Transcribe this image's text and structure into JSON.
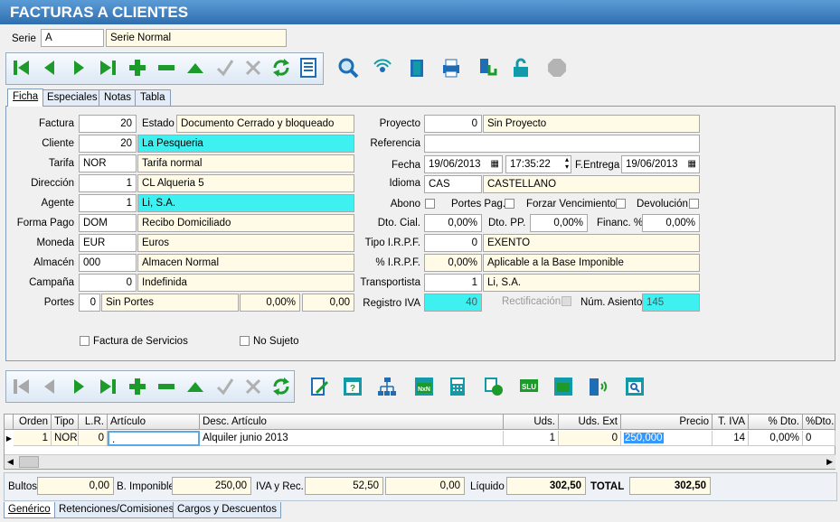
{
  "title": "FACTURAS A CLIENTES",
  "serie": {
    "label": "Serie",
    "code": "A",
    "name": "Serie Normal"
  },
  "tabs": [
    "Ficha",
    "Especiales",
    "Notas",
    "Tabla"
  ],
  "left": {
    "factura": {
      "label": "Factura",
      "value": "20"
    },
    "estado": {
      "label": "Estado",
      "value": "Documento Cerrado y bloqueado"
    },
    "cliente": {
      "label": "Cliente",
      "code": "20",
      "name": "La Pesqueria"
    },
    "tarifa": {
      "label": "Tarifa",
      "code": "NOR",
      "name": "Tarifa normal"
    },
    "direccion": {
      "label": "Dirección",
      "code": "1",
      "name": "CL  Alqueria 5"
    },
    "agente": {
      "label": "Agente",
      "code": "1",
      "name": "Li, S.A."
    },
    "forma_pago": {
      "label": "Forma Pago",
      "code": "DOM",
      "name": "Recibo Domiciliado"
    },
    "moneda": {
      "label": "Moneda",
      "code": "EUR",
      "name": "Euros"
    },
    "almacen": {
      "label": "Almacén",
      "code": "000",
      "name": "Almacen Normal"
    },
    "campana": {
      "label": "Campaña",
      "code": "0",
      "name": "Indefinida"
    },
    "portes": {
      "label": "Portes",
      "code": "0",
      "name": "Sin Portes",
      "pct": "0,00%",
      "amount": "0,00"
    }
  },
  "right": {
    "proyecto": {
      "label": "Proyecto",
      "code": "0",
      "name": "Sin Proyecto"
    },
    "referencia": {
      "label": "Referencia",
      "value": ""
    },
    "fecha": {
      "label": "Fecha",
      "date": "19/06/2013",
      "time": "17:35:22"
    },
    "entrega": {
      "label": "F.Entrega",
      "date": "19/06/2013"
    },
    "idioma": {
      "label": "Idioma",
      "code": "CAS",
      "name": "CASTELLANO"
    },
    "checks": {
      "abono": "Abono",
      "portes_pag": "Portes Pag.",
      "forzar": "Forzar Vencimientos",
      "devolucion": "Devolución"
    },
    "dto_cial": {
      "label": "Dto. Cial.",
      "value": "0,00%"
    },
    "dto_pp": {
      "label": "Dto. PP.",
      "value": "0,00%"
    },
    "financ": {
      "label": "Financ. %",
      "value": "0,00%"
    },
    "tipo_irpf": {
      "label": "Tipo I.R.P.F.",
      "code": "0",
      "name": "EXENTO"
    },
    "pct_irpf": {
      "label": "% I.R.P.F.",
      "value": "0,00%",
      "name": "Aplicable a la Base Imponible"
    },
    "transportista": {
      "label": "Transportista",
      "code": "1",
      "name": "Li, S.A."
    },
    "registro_iva": {
      "label": "Registro IVA",
      "value": "40"
    },
    "rectificacion": {
      "label": "Rectificación"
    },
    "num_asiento": {
      "label": "Núm. Asiento",
      "value": "145"
    }
  },
  "bottom_checks": {
    "servicios": "Factura de Servicios",
    "no_sujeto": "No Sujeto"
  },
  "grid": {
    "headers": [
      "Orden",
      "Tipo",
      "L.R.",
      "Artículo",
      "Desc. Artículo",
      "Uds.",
      "Uds. Ext",
      "Precio",
      "T. IVA",
      "% Dto.",
      "%Dto.2"
    ],
    "row": [
      "1",
      "NOR",
      "0",
      ".",
      "Alquiler junio 2013",
      "1",
      "0",
      "250,000",
      "14",
      "0,00%",
      "0"
    ]
  },
  "totals": {
    "bultos_label": "Bultos",
    "bultos": "0,00",
    "base_label": "B. Imponible",
    "base": "250,00",
    "iva_label": "IVA y Rec.",
    "iva": "52,50",
    "rec": "0,00",
    "liquido_label": "Líquido",
    "liquido": "302,50",
    "total_label": "TOTAL",
    "total": "302,50"
  },
  "bottom_tabs": [
    "Genérico",
    "Retenciones/Comisiones",
    "Cargos y Descuentos"
  ],
  "colors": {
    "title_bar": "#2f6fb0",
    "highlight": "#3ff0f0",
    "readonly": "#fffbe6",
    "nav_green": "#1c9a2a"
  },
  "toolbar1_icons": [
    "first-icon",
    "prev-icon",
    "next-icon",
    "last-icon",
    "add-icon",
    "delete-icon",
    "edit-icon",
    "confirm-icon",
    "cancel-icon",
    "refresh-icon",
    "list-icon",
    "search-icon",
    "signal-icon",
    "door-icon",
    "print-icon",
    "touch-icon",
    "unlock-icon",
    "stop-icon"
  ],
  "toolbar2_icons": [
    "first-icon",
    "prev-icon",
    "next-icon",
    "last-icon",
    "add-icon",
    "delete-icon",
    "edit-icon",
    "confirm-icon",
    "cancel-icon",
    "refresh-icon",
    "edit-doc-icon",
    "help-window-icon",
    "hierarchy-icon",
    "nxn-icon",
    "calculator-icon",
    "currency-icon",
    "slu-icon",
    "money-icon",
    "door-signal-icon",
    "window-search-icon"
  ]
}
